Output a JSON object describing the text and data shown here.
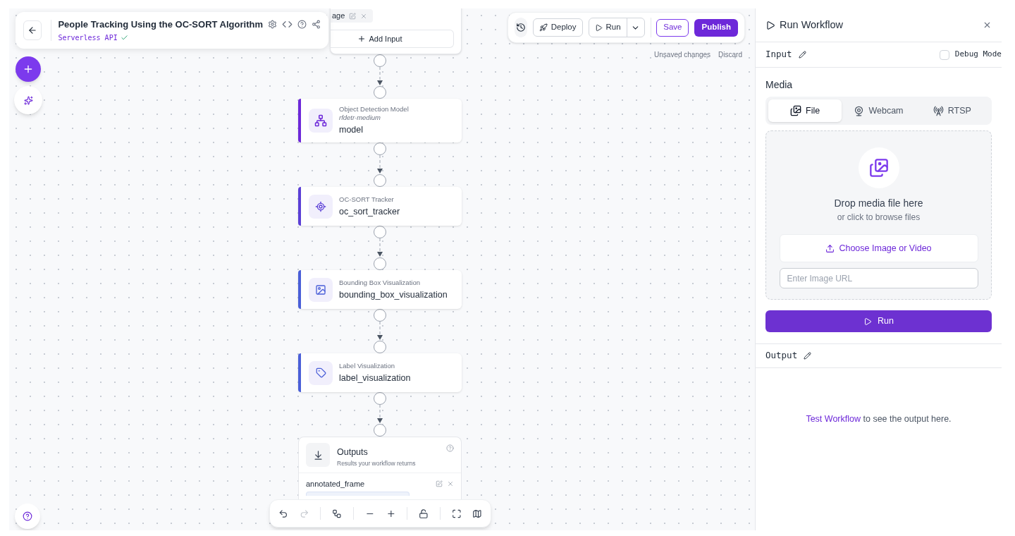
{
  "header": {
    "title": "People Tracking Using the OC-SORT Algorithm",
    "subtitle": "Serverless API",
    "verified": true
  },
  "toolbar": {
    "deploy": "Deploy",
    "run": "Run",
    "save": "Save",
    "publish": "Publish",
    "status": "Unsaved changes",
    "discard": "Discard"
  },
  "input_node": {
    "chip": "age",
    "button": "Add Input"
  },
  "nodes": [
    {
      "kind": "model",
      "type": "Object Detection Model",
      "model": "rfdetr-medium",
      "name": "model",
      "color": "#6d28d9"
    },
    {
      "kind": "tracker",
      "type": "OC-SORT Tracker",
      "name": "oc_sort_tracker",
      "color": "#5b3fd6"
    },
    {
      "kind": "box_visualization",
      "type": "Bounding Box Visualization",
      "name": "bounding_box_visualization",
      "color": "#4a5fd8"
    },
    {
      "kind": "label_visualization",
      "type": "Label Visualization",
      "name": "label_visualization",
      "color": "#4a5fd8"
    }
  ],
  "outputs_node": {
    "title": "Outputs",
    "subtitle": "Results your workflow returns",
    "fields": [
      {
        "name": "annotated_frame"
      }
    ]
  },
  "panel": {
    "title": "Run Workflow",
    "input_label": "Input",
    "debug_mode": {
      "label": "Debug Mode",
      "checked": false
    },
    "media_label": "Media",
    "media_tabs": [
      {
        "kind": "file",
        "label": "File",
        "selected": true
      },
      {
        "kind": "webcam",
        "label": "Webcam",
        "selected": false
      },
      {
        "kind": "rtsp",
        "label": "RTSP",
        "selected": false
      }
    ],
    "drop_title": "Drop media file here",
    "drop_hint": "or click to browse files",
    "choose_button": "Choose Image or Video",
    "url_placeholder": "Enter Image URL",
    "run_button": "Run",
    "output_label": "Output",
    "output_message": {
      "link": "Test Workflow",
      "text": "to see the output here."
    }
  }
}
